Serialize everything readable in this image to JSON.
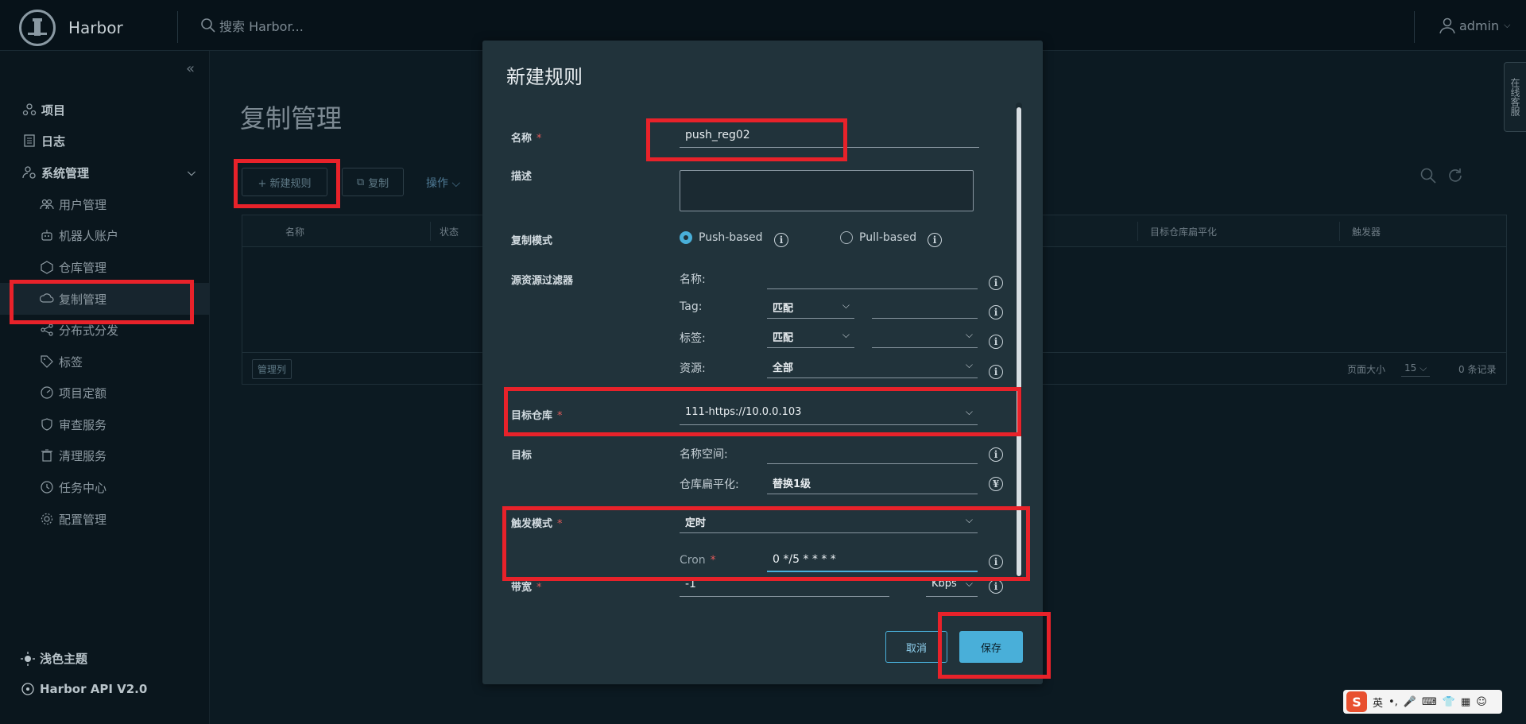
{
  "header": {
    "brand": "Harbor",
    "search_placeholder": "搜索 Harbor...",
    "user": "admin"
  },
  "sidebar": {
    "items": [
      {
        "label": "项目",
        "icon": "projects-icon"
      },
      {
        "label": "日志",
        "icon": "logs-icon"
      },
      {
        "label": "系统管理",
        "icon": "admin-icon"
      },
      {
        "label": "用户管理",
        "icon": "users-icon"
      },
      {
        "label": "机器人账户",
        "icon": "robot-icon"
      },
      {
        "label": "仓库管理",
        "icon": "registry-icon"
      },
      {
        "label": "复制管理",
        "icon": "replication-icon"
      },
      {
        "label": "分布式分发",
        "icon": "distribution-icon"
      },
      {
        "label": "标签",
        "icon": "tag-icon"
      },
      {
        "label": "项目定额",
        "icon": "quota-icon"
      },
      {
        "label": "审查服务",
        "icon": "shield-icon"
      },
      {
        "label": "清理服务",
        "icon": "trash-icon"
      },
      {
        "label": "任务中心",
        "icon": "clock-icon"
      },
      {
        "label": "配置管理",
        "icon": "gear-icon"
      }
    ],
    "footer": {
      "theme": "浅色主题",
      "api": "Harbor API V2.0"
    }
  },
  "main": {
    "title": "复制管理",
    "toolbar": {
      "new_rule": "+ 新建规则",
      "copy": "复制",
      "actions": "操作"
    },
    "table": {
      "columns": [
        "名称",
        "状态",
        "目标仓库扁平化",
        "触发器"
      ],
      "manage_columns": "管理列",
      "page_size_label": "页面大小",
      "page_size": "15",
      "records": "0 条记录"
    }
  },
  "side_tab": "在线客服",
  "modal": {
    "title": "新建规则",
    "name_label": "名称",
    "name_value": "push_reg02",
    "desc_label": "描述",
    "mode_label": "复制模式",
    "mode_push": "Push-based",
    "mode_pull": "Pull-based",
    "filter_label": "源资源过滤器",
    "filter_name": "名称:",
    "filter_tag": "Tag:",
    "filter_tag_match": "匹配",
    "filter_label_label": "标签:",
    "filter_label_match": "匹配",
    "filter_resource": "资源:",
    "filter_resource_value": "全部",
    "target_registry_label": "目标仓库",
    "target_registry_value": "111-https://10.0.0.103",
    "target_label": "目标",
    "namespace_label": "名称空间:",
    "flatten_label": "仓库扁平化:",
    "flatten_value": "替换1级",
    "trigger_label": "触发模式",
    "trigger_value": "定时",
    "cron_label": "Cron",
    "cron_value": "0 */5 * * * *",
    "bandwidth_label": "带宽",
    "bandwidth_value": "-1",
    "bandwidth_unit": "Kbps",
    "cancel": "取消",
    "save": "保存"
  },
  "ime": {
    "lang": "英"
  },
  "colors": {
    "accent": "#49afd9",
    "highlight": "#e8222a",
    "modal_bg": "#21333b",
    "page_bg": "#0c1a22"
  }
}
